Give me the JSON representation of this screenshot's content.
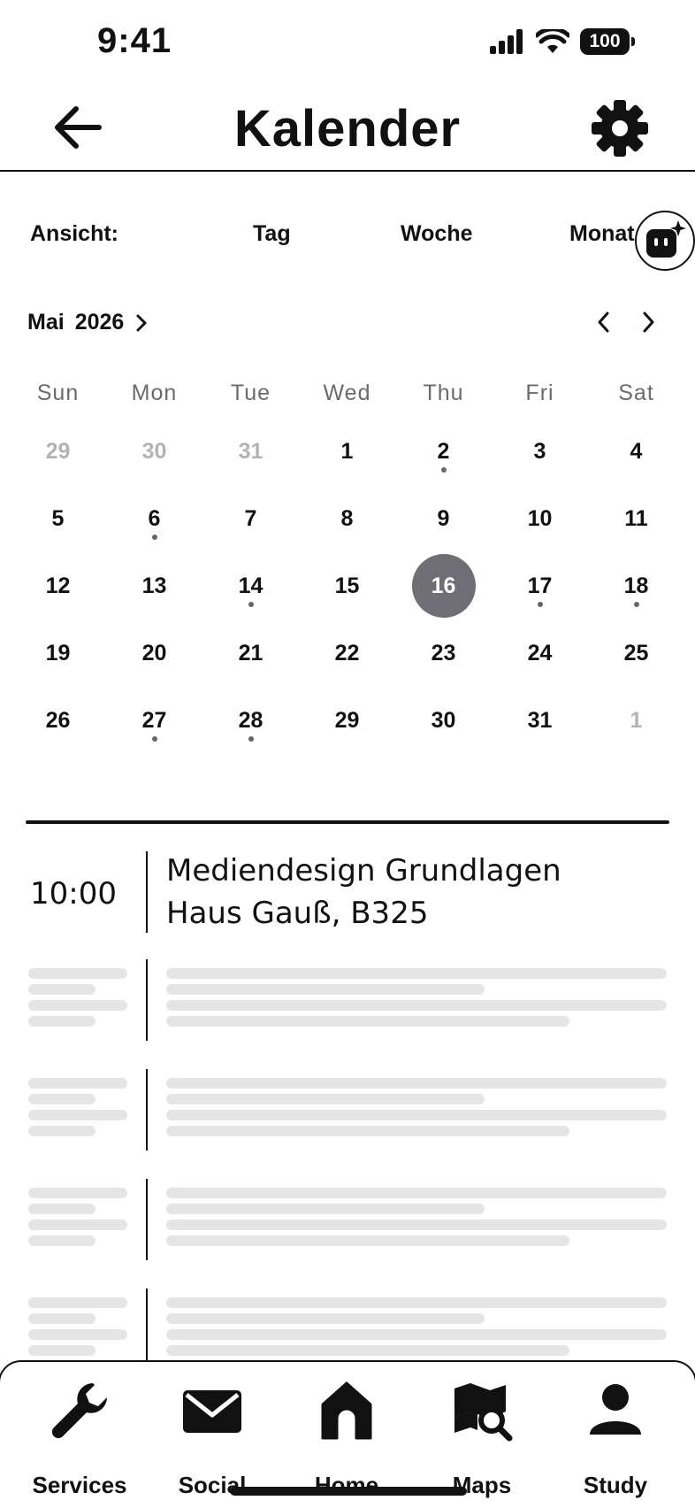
{
  "status_bar": {
    "time": "9:41",
    "battery": "100"
  },
  "header": {
    "title": "Kalender"
  },
  "view": {
    "label": "Ansicht:",
    "tabs": [
      "Tag",
      "Woche",
      "Monat"
    ]
  },
  "month_nav": {
    "month": "Mai",
    "year": "2026"
  },
  "calendar": {
    "weekdays": [
      "Sun",
      "Mon",
      "Tue",
      "Wed",
      "Thu",
      "Fri",
      "Sat"
    ],
    "days": [
      {
        "n": "29",
        "muted": true
      },
      {
        "n": "30",
        "muted": true
      },
      {
        "n": "31",
        "muted": true
      },
      {
        "n": "1"
      },
      {
        "n": "2",
        "dot": true
      },
      {
        "n": "3"
      },
      {
        "n": "4"
      },
      {
        "n": "5"
      },
      {
        "n": "6",
        "dot": true
      },
      {
        "n": "7"
      },
      {
        "n": "8"
      },
      {
        "n": "9"
      },
      {
        "n": "10"
      },
      {
        "n": "11"
      },
      {
        "n": "12"
      },
      {
        "n": "13"
      },
      {
        "n": "14",
        "dot": true
      },
      {
        "n": "15"
      },
      {
        "n": "16",
        "selected": true
      },
      {
        "n": "17",
        "dot": true
      },
      {
        "n": "18",
        "dot": true
      },
      {
        "n": "19"
      },
      {
        "n": "20"
      },
      {
        "n": "21"
      },
      {
        "n": "22"
      },
      {
        "n": "23"
      },
      {
        "n": "24"
      },
      {
        "n": "25"
      },
      {
        "n": "26"
      },
      {
        "n": "27",
        "dot": true
      },
      {
        "n": "28",
        "dot": true
      },
      {
        "n": "29"
      },
      {
        "n": "30"
      },
      {
        "n": "31"
      },
      {
        "n": "1",
        "muted": true
      }
    ]
  },
  "agenda": {
    "events": [
      {
        "time": "10:00",
        "title": "Mediendesign Grundlagen",
        "room": "Haus Gauß, B325"
      }
    ],
    "placeholder_count": 4
  },
  "bottom_nav": {
    "items": [
      {
        "label": "Services",
        "icon": "wrench-icon"
      },
      {
        "label": "Social",
        "icon": "mail-icon"
      },
      {
        "label": "Home",
        "icon": "home-icon"
      },
      {
        "label": "Maps",
        "icon": "map-search-icon"
      },
      {
        "label": "Study",
        "icon": "person-icon"
      }
    ]
  },
  "colors": {
    "selected_day": "#6e6e74",
    "muted_day": "#b3b3b3",
    "skeleton": "#e5e5e5",
    "text": "#111111"
  }
}
